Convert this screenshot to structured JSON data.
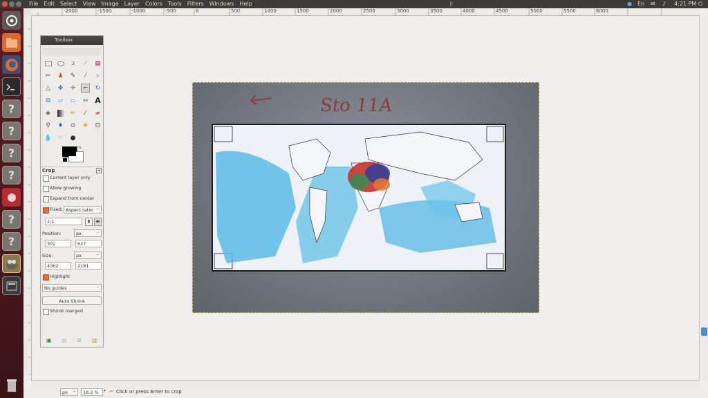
{
  "menubar": {
    "items": [
      "File",
      "Edit",
      "Select",
      "View",
      "Image",
      "Layer",
      "Colors",
      "Tools",
      "Filters",
      "Windows",
      "Help"
    ]
  },
  "tray": {
    "time": "4:21 PM"
  },
  "ruler": {
    "labels": [
      "-2000",
      "-1500",
      "-1000",
      "-500",
      "0",
      "500",
      "1000",
      "1500",
      "2000",
      "2500",
      "3000",
      "3500",
      "4000",
      "4500",
      "5000",
      "5500",
      "6000"
    ]
  },
  "photo": {
    "handwriting": "Sto 11A"
  },
  "toolbox": {
    "title": "Toolbox",
    "tool_options": {
      "title": "Crop",
      "current_layer_only": {
        "label": "Current layer only",
        "checked": false
      },
      "allow_growing": {
        "label": "Allow growing",
        "checked": false
      },
      "expand_from_center": {
        "label": "Expand from center",
        "checked": false
      },
      "fixed": {
        "label": "Fixed:",
        "checked": true,
        "mode": "Aspect ratio",
        "value": "2:1"
      },
      "position": {
        "label": "Position:",
        "unit": "px",
        "x": "302",
        "y": "627"
      },
      "size": {
        "label": "Size:",
        "unit": "px",
        "w": "4362",
        "h": "2181"
      },
      "highlight": {
        "label": "Highlight",
        "checked": true
      },
      "guides": "No guides",
      "auto_shrink": "Auto Shrink",
      "shrink_merged": {
        "label": "Shrink merged",
        "checked": false
      }
    }
  },
  "statusbar": {
    "unit": "px",
    "zoom": "18.2 %",
    "message": "Click or press Enter to crop"
  },
  "colors": {
    "topbar": "#3c3b37",
    "launcher": "#4a1a20",
    "accent": "#e0703c"
  }
}
